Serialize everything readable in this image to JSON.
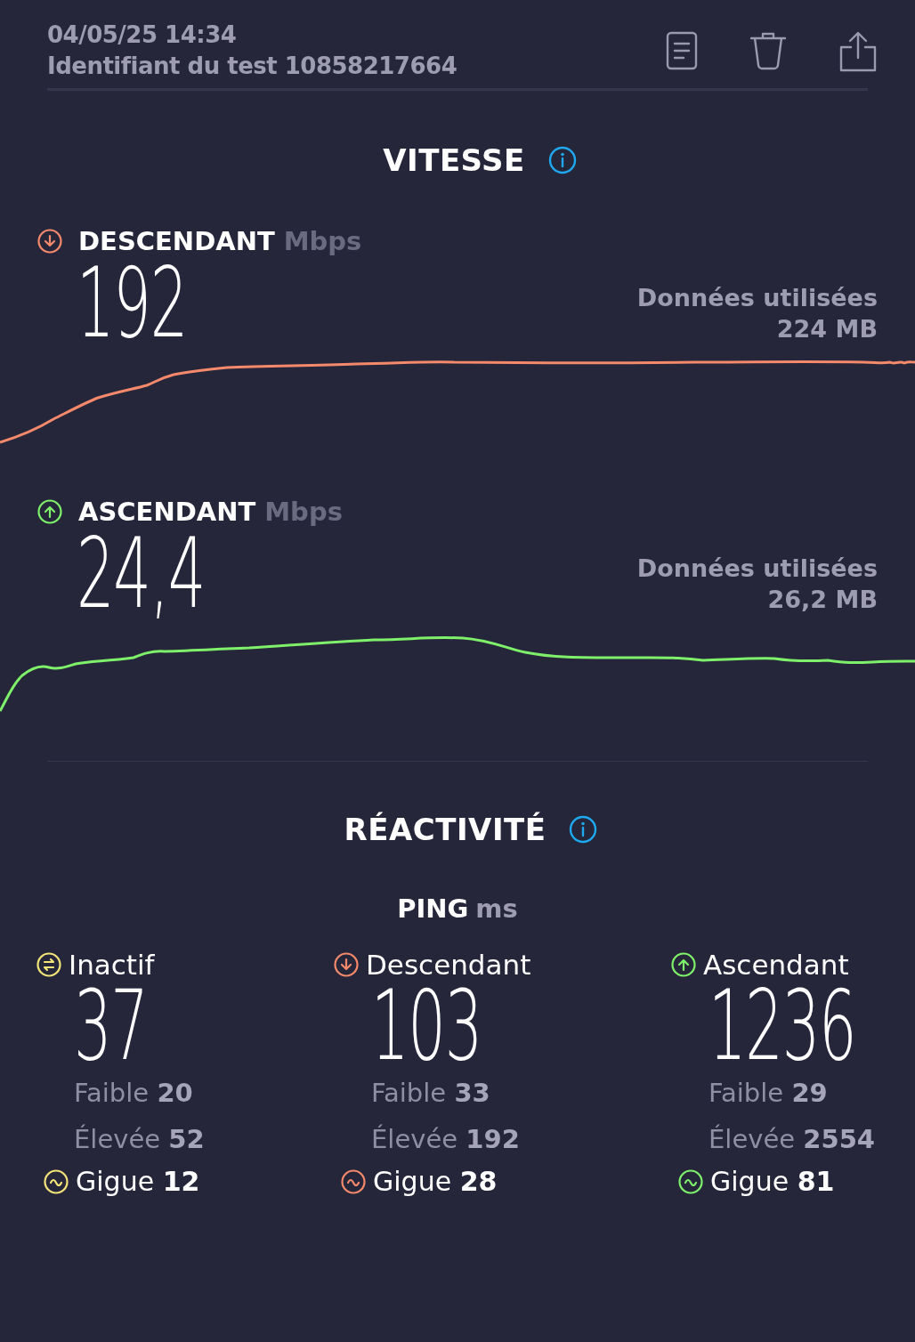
{
  "header": {
    "datetime": "04/05/25 14:34",
    "test_id": "Identifiant du test 10858217664"
  },
  "speed": {
    "title": "VITESSE",
    "tests": [
      {
        "kind": "download",
        "label": "DESCENDANT",
        "unit": "Mbps",
        "value": "192",
        "data_label": "Données utilisées",
        "data_amount": "224 MB",
        "color": "#f4896b"
      },
      {
        "kind": "upload",
        "label": "ASCENDANT",
        "unit": "Mbps",
        "value": "24,4",
        "data_label": "Données utilisées",
        "data_amount": "26,2 MB",
        "color": "#7ef06a"
      }
    ]
  },
  "responsiveness": {
    "title": "RÉACTIVITÉ",
    "ping_label": "PING",
    "ping_unit": "ms",
    "columns": [
      {
        "kind": "idle",
        "label": "Inactif",
        "value": "37",
        "low_label": "Faible",
        "low": "20",
        "high_label": "Élevée",
        "high": "52",
        "jitter_label": "Gigue",
        "jitter": "12",
        "color": "#f3e57a"
      },
      {
        "kind": "download",
        "label": "Descendant",
        "value": "103",
        "low_label": "Faible",
        "low": "33",
        "high_label": "Élevée",
        "high": "192",
        "jitter_label": "Gigue",
        "jitter": "28",
        "color": "#f4896b"
      },
      {
        "kind": "upload",
        "label": "Ascendant",
        "value": "1236",
        "low_label": "Faible",
        "low": "29",
        "high_label": "Élevée",
        "high": "2554",
        "jitter_label": "Gigue",
        "jitter": "81",
        "color": "#7ef06a"
      }
    ]
  }
}
